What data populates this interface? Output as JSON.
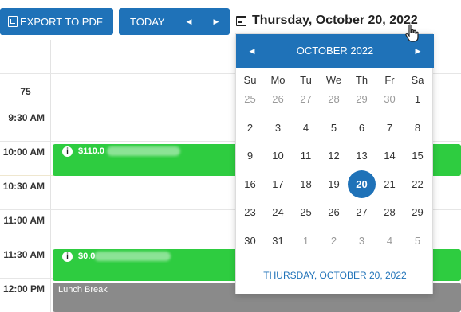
{
  "toolbar": {
    "export_label": "EXPORT TO PDF",
    "today_label": "TODAY",
    "prev_symbol": "◀",
    "next_symbol": "▶",
    "current_date": "Thursday, October 20, 2022"
  },
  "schedule": {
    "header_number": "75",
    "times": [
      "9:30 AM",
      "10:00 AM",
      "10:30 AM",
      "11:00 AM",
      "11:30 AM",
      "12:00 PM"
    ],
    "events": [
      {
        "amount": "$110.0",
        "color": "#2ecc40"
      },
      {
        "amount": "$0.0",
        "color": "#2ecc40"
      },
      {
        "label": "Lunch Break",
        "color": "#8a8a8a"
      }
    ]
  },
  "datepicker": {
    "month_title": "OCTOBER 2022",
    "weekdays": [
      "Su",
      "Mo",
      "Tu",
      "We",
      "Th",
      "Fr",
      "Sa"
    ],
    "weeks": [
      [
        "25",
        "26",
        "27",
        "28",
        "29",
        "30",
        "1"
      ],
      [
        "2",
        "3",
        "4",
        "5",
        "6",
        "7",
        "8"
      ],
      [
        "9",
        "10",
        "11",
        "12",
        "13",
        "14",
        "15"
      ],
      [
        "16",
        "17",
        "18",
        "19",
        "20",
        "21",
        "22"
      ],
      [
        "23",
        "24",
        "25",
        "26",
        "27",
        "28",
        "29"
      ],
      [
        "30",
        "31",
        "1",
        "2",
        "3",
        "4",
        "5"
      ]
    ],
    "selected_day": "20",
    "footer": "THURSDAY, OCTOBER 20, 2022"
  },
  "colors": {
    "accent": "#1f72b8",
    "event_green": "#2ecc40",
    "lunch_gray": "#8a8a8a"
  }
}
